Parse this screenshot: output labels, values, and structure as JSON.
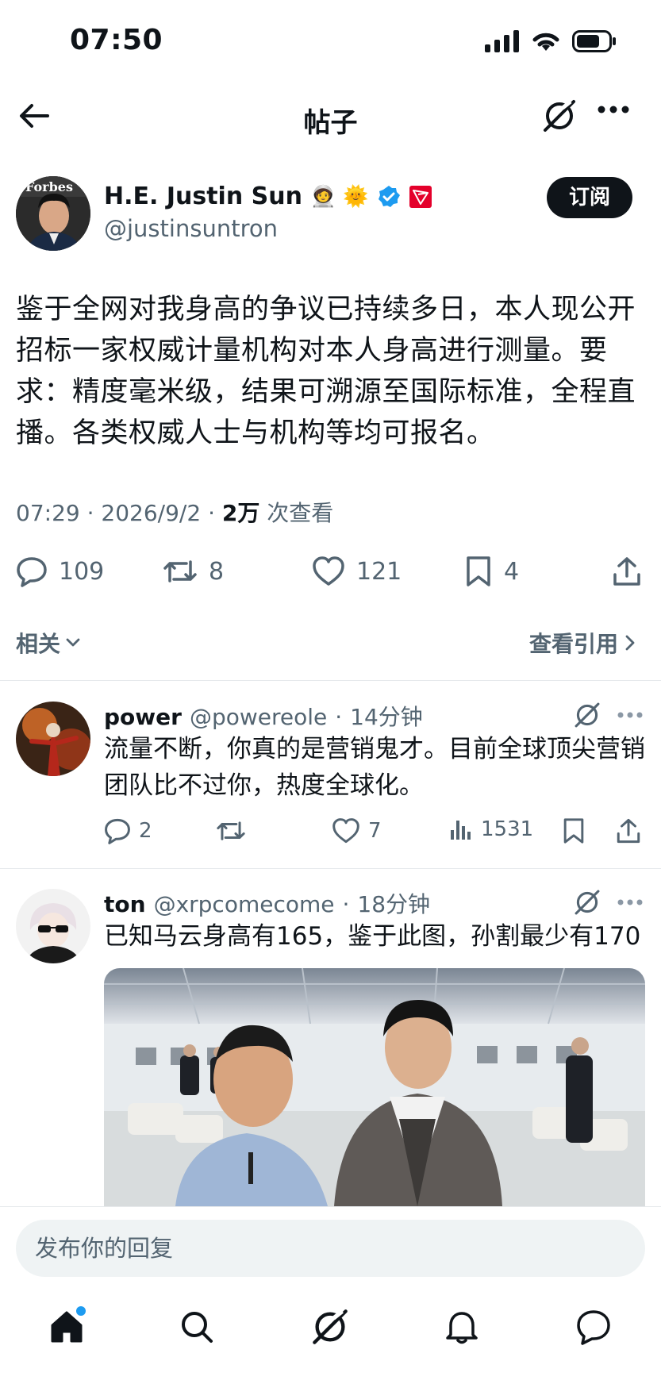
{
  "status_bar": {
    "time": "07:50"
  },
  "header": {
    "title": "帖子"
  },
  "author": {
    "name": "H.E. Justin Sun",
    "emojis": "🧑‍🚀 🌞",
    "handle": "@justinsuntron",
    "subscribe_label": "订阅",
    "avatar_text": "Forbes"
  },
  "post": {
    "text": "鉴于全网对我身高的争议已持续多日，本人现公开招标一家权威计量机构对本人身高进行测量。要求：精度毫米级，结果可溯源至国际标准，全程直播。各类权威人士与机构等均可报名。",
    "time": "07:29",
    "date": "2026/9/2",
    "views": "2万",
    "views_suffix": "次查看",
    "replies": "109",
    "reposts": "8",
    "likes": "121",
    "bookmarks": "4"
  },
  "related_label": "相关",
  "quotes_label": "查看引用",
  "replies": [
    {
      "name": "power",
      "handle": "@powereole",
      "time": "14分钟",
      "text": "流量不断，你真的是营销鬼才。目前全球顶尖营销团队比不过你，热度全球化。",
      "replies": "2",
      "reposts": "",
      "likes": "7",
      "views": "1531"
    },
    {
      "name": "ton",
      "handle": "@xrpcomecome",
      "time": "18分钟",
      "text": "已知马云身高有165，鉴于此图，孙割最少有170"
    }
  ],
  "composer": {
    "placeholder": "发布你的回复"
  },
  "colors": {
    "accent": "#1d9bf0",
    "text": "#0f1419",
    "secondary": "#536471",
    "tron": "#e4002b"
  },
  "icons": [
    "back-arrow-icon",
    "grok-icon",
    "more-icon",
    "verified-icon",
    "tron-icon",
    "reply-icon",
    "repost-icon",
    "like-icon",
    "bookmark-icon",
    "share-icon",
    "views-icon",
    "home-icon",
    "search-icon",
    "bell-icon",
    "messages-icon"
  ]
}
